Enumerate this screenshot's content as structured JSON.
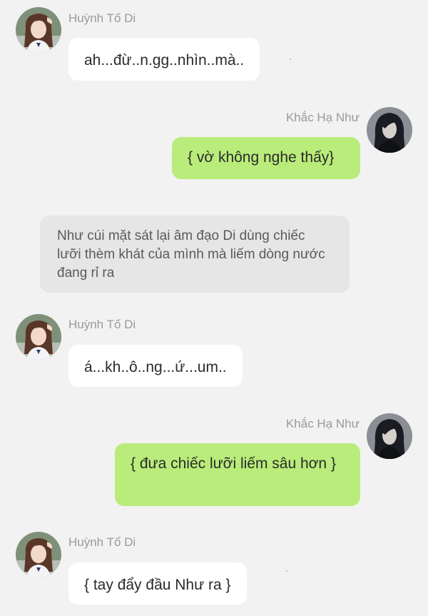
{
  "messages": [
    {
      "sender": "Huỳnh Tố Di",
      "text": "ah...đừ..n.gg..nhìn..mà.."
    },
    {
      "sender": "Khắc Hạ Như",
      "text": "{ vờ không nghe thấy}"
    },
    {
      "narration": "Như cúi mặt sát lại âm đạo Di dùng chiếc lưỡi thèm khát của mình mà liếm dòng nước đang rỉ ra"
    },
    {
      "sender": "Huỳnh Tố Di",
      "text": "á...kh..ô..ng...ứ...um.."
    },
    {
      "sender": "Khắc Hạ Như",
      "text": "{ đưa chiếc lưỡi liếm sâu hơn }"
    },
    {
      "sender": "Huỳnh Tố Di",
      "text": "{ tay đẩy đầu Như ra }"
    }
  ],
  "colors": {
    "background": "#f2f2f2",
    "incoming_bubble": "#ffffff",
    "outgoing_bubble": "#b9ec7a",
    "narration_bubble": "#e6e6e6",
    "sender_name": "#9a9a9a"
  }
}
